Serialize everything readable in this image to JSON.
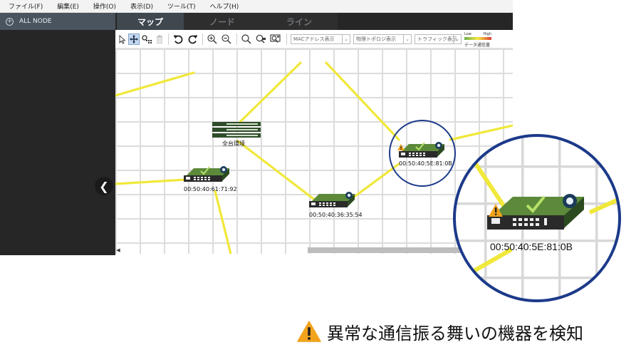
{
  "menu": {
    "items": [
      "ファイル(F)",
      "編集(E)",
      "操作(O)",
      "表示(D)",
      "ツール(T)",
      "ヘルプ(H)"
    ]
  },
  "sidebar": {
    "tree_root": "ALL NODE"
  },
  "tabs": [
    {
      "label": "マップ",
      "active": true
    },
    {
      "label": "ノード",
      "active": false
    },
    {
      "label": "ライン",
      "active": false
    }
  ],
  "toolbar": {
    "tools": [
      "pointer-icon",
      "move-icon",
      "layout-icon",
      "trash-icon",
      "undo-icon",
      "redo-icon",
      "zoom-in-icon",
      "zoom-out-icon",
      "search-icon",
      "find-node-icon",
      "find-route-icon"
    ],
    "dropdowns": [
      "MACアドレス表示",
      "物理トポロジ表示",
      "トラフィック表示"
    ],
    "traffic_legend": {
      "low": "Low",
      "high": "High",
      "label": "データ通信量"
    }
  },
  "map": {
    "group_label": "全台環境",
    "nodes": [
      {
        "mac": "00:50:40:61:71:92",
        "status": "ok"
      },
      {
        "mac": "00:50:40:36:35:54",
        "status": "ok"
      },
      {
        "mac": "00:50:40:5E:81:0B",
        "status": "warning"
      }
    ]
  },
  "zoom": {
    "mac": "00:50:40:5E:81:0B"
  },
  "caption": {
    "text": "異常な通信振る舞いの機器を検知"
  },
  "colors": {
    "link": "#f0e83a",
    "highlight_ring": "#1c3a8a",
    "warning": "#f2a31c",
    "switch_green": "#3d6b2f",
    "sidebar_bg": "#262626"
  }
}
